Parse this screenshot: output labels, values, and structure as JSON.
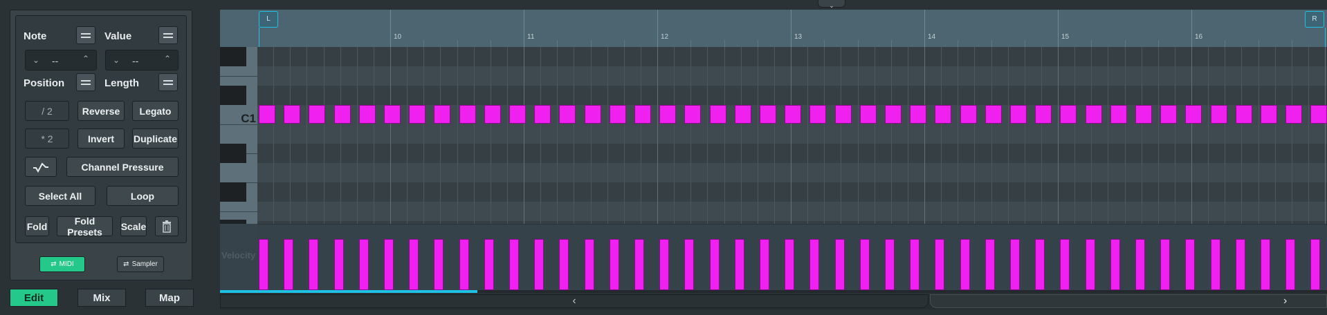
{
  "toolbar": {
    "note_label": "Note",
    "value_label": "Value",
    "note_value": "--",
    "value_value": "--",
    "position_label": "Position",
    "length_label": "Length",
    "div2": "/ 2",
    "reverse": "Reverse",
    "legato": "Legato",
    "mul2": "* 2",
    "invert": "Invert",
    "duplicate": "Duplicate",
    "channel_pressure": "Channel Pressure",
    "select_all": "Select All",
    "loop": "Loop",
    "fold": "Fold",
    "fold_presets": "Fold Presets",
    "scale": "Scale",
    "midi": "MIDI",
    "sampler": "Sampler"
  },
  "tabs": {
    "edit": "Edit",
    "mix": "Mix",
    "map": "Map"
  },
  "ruler": {
    "left_marker": "L",
    "right_marker": "R",
    "bars": [
      "10",
      "11",
      "12",
      "13",
      "14",
      "15",
      "16"
    ]
  },
  "piano": {
    "c1_label": "C1"
  },
  "velocity": {
    "label": "Velocity"
  },
  "colors": {
    "note": "#f020f0",
    "accent": "#1fc2e4",
    "active_tab": "#24c98a"
  },
  "icons": {
    "collapse": "chevron-down-icon",
    "curve": "curve-icon",
    "delete": "trash-icon",
    "scroll_left": "chevron-left-icon",
    "scroll_right": "chevron-right-icon"
  }
}
